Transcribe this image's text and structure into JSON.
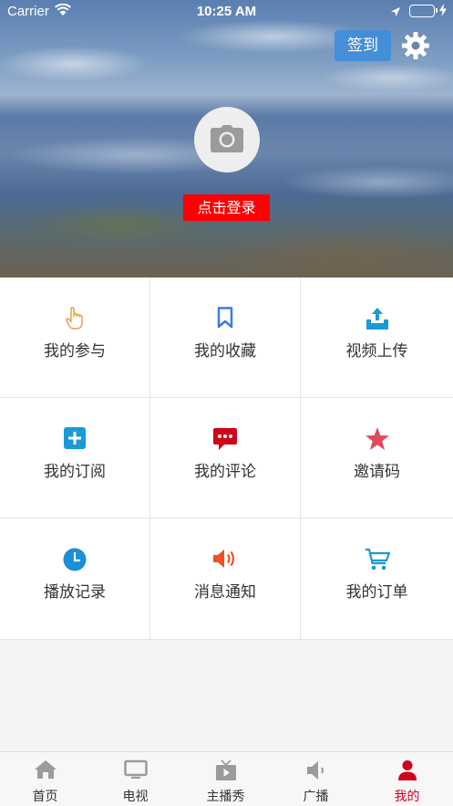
{
  "status_bar": {
    "carrier": "Carrier",
    "time": "10:25 AM"
  },
  "header": {
    "signin_label": "签到",
    "login_label": "点击登录"
  },
  "colors": {
    "login_red": "#ff0000",
    "signin_blue": "#3c8cdc",
    "active_tab": "#d0021b"
  },
  "grid": {
    "items": [
      {
        "label": "我的参与",
        "icon": "hand-pointer-icon"
      },
      {
        "label": "我的收藏",
        "icon": "bookmark-icon"
      },
      {
        "label": "视频上传",
        "icon": "upload-tray-icon"
      },
      {
        "label": "我的订阅",
        "icon": "plus-square-icon"
      },
      {
        "label": "我的评论",
        "icon": "comment-icon"
      },
      {
        "label": "邀请码",
        "icon": "star-icon"
      },
      {
        "label": "播放记录",
        "icon": "clock-icon"
      },
      {
        "label": "消息通知",
        "icon": "speaker-icon"
      },
      {
        "label": "我的订单",
        "icon": "cart-icon"
      }
    ]
  },
  "tabbar": {
    "items": [
      {
        "label": "首页",
        "icon": "home-icon"
      },
      {
        "label": "电视",
        "icon": "tv-icon"
      },
      {
        "label": "主播秀",
        "icon": "video-play-icon"
      },
      {
        "label": "广播",
        "icon": "radio-speaker-icon"
      },
      {
        "label": "我的",
        "icon": "person-icon",
        "active": true
      }
    ]
  }
}
